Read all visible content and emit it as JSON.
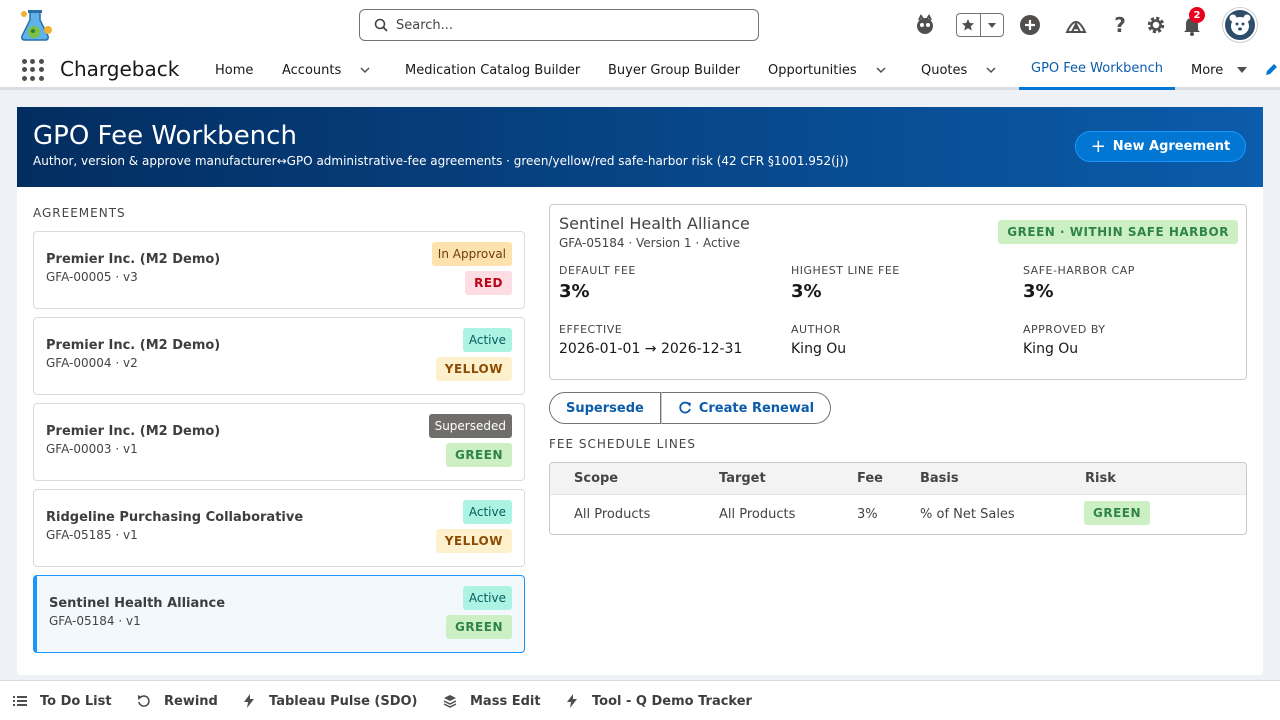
{
  "header": {
    "search_placeholder": "Search...",
    "notification_count": "2"
  },
  "nav": {
    "app_name": "Chargeback",
    "items": [
      {
        "label": "Home"
      },
      {
        "label": "Accounts"
      },
      {
        "label": "Medication Catalog Builder"
      },
      {
        "label": "Buyer Group Builder"
      },
      {
        "label": "Opportunities"
      },
      {
        "label": "Quotes"
      },
      {
        "label": "GPO Fee Workbench"
      },
      {
        "label": "More"
      }
    ]
  },
  "banner": {
    "title": "GPO Fee Workbench",
    "subtitle": "Author, version & approve manufacturer↔GPO administrative-fee agreements · green/yellow/red safe-harbor risk (42 CFR §1001.952(j))",
    "new_button": "New Agreement"
  },
  "agreements": {
    "label": "AGREEMENTS",
    "items": [
      {
        "name": "Premier Inc. (M2 Demo)",
        "id": "GFA-00005 · v3",
        "status": "In Approval",
        "risk": "RED"
      },
      {
        "name": "Premier Inc. (M2 Demo)",
        "id": "GFA-00004 · v2",
        "status": "Active",
        "risk": "YELLOW"
      },
      {
        "name": "Premier Inc. (M2 Demo)",
        "id": "GFA-00003 · v1",
        "status": "Superseded",
        "risk": "GREEN"
      },
      {
        "name": "Ridgeline Purchasing Collaborative",
        "id": "GFA-05185 · v1",
        "status": "Active",
        "risk": "YELLOW"
      },
      {
        "name": "Sentinel Health Alliance",
        "id": "GFA-05184 · v1",
        "status": "Active",
        "risk": "GREEN"
      }
    ]
  },
  "detail": {
    "title": "Sentinel Health Alliance",
    "subtitle": "GFA-05184 · Version 1 · Active",
    "badge": "GREEN · WITHIN SAFE HARBOR",
    "default_fee_label": "DEFAULT FEE",
    "default_fee": "3%",
    "highest_fee_label": "HIGHEST LINE FEE",
    "highest_fee": "3%",
    "cap_label": "SAFE-HARBOR CAP",
    "cap": "3%",
    "effective_label": "EFFECTIVE",
    "effective": "2026-01-01 → 2026-12-31",
    "author_label": "AUTHOR",
    "author": "King Ou",
    "approved_label": "APPROVED BY",
    "approved": "King Ou"
  },
  "actions": {
    "supersede": "Supersede",
    "renewal": "Create Renewal"
  },
  "fee_schedule": {
    "label": "FEE SCHEDULE LINES",
    "headers": [
      "Scope",
      "Target",
      "Fee",
      "Basis",
      "Risk"
    ],
    "rows": [
      [
        "All Products",
        "All Products",
        "3%",
        "% of Net Sales",
        "GREEN"
      ]
    ]
  },
  "utility_bar": {
    "items": [
      {
        "label": "To Do List",
        "icon": "list-icon"
      },
      {
        "label": "Rewind",
        "icon": "rewind-icon"
      },
      {
        "label": "Tableau Pulse (SDO)",
        "icon": "lightning-icon"
      },
      {
        "label": "Mass Edit",
        "icon": "layers-icon"
      },
      {
        "label": "Tool - Q Demo Tracker",
        "icon": "lightning-icon"
      }
    ]
  }
}
